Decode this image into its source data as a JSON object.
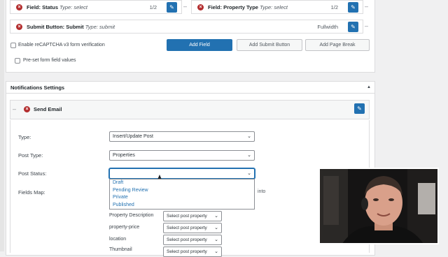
{
  "fields": [
    {
      "name": "Field: Status",
      "type": "Type: select",
      "width": "1/2"
    },
    {
      "name": "Field: Property Type",
      "type": "Type: select",
      "width": "1/2"
    },
    {
      "name": "Submit Button: Submit",
      "type": "Type: submit",
      "width": "Fullwidth"
    }
  ],
  "form_options": {
    "recaptcha_label": "Enable reCAPTCHA v3 form verification",
    "preset_label": "Pre-set form field values",
    "add_field": "Add Field",
    "add_submit": "Add Submit Button",
    "add_page_break": "Add Page Break"
  },
  "notifications": {
    "title": "Notifications Settings",
    "collapse_glyph": "▲",
    "action_title": "Send Email",
    "type_label": "Type:",
    "type_value": "Insert/Update Post",
    "post_type_label": "Post Type:",
    "post_type_value": "Properties",
    "post_status_label": "Post Status:",
    "post_status_value": "",
    "status_options": [
      "Draft",
      "Pending Review",
      "Private",
      "Published"
    ],
    "fields_map_label": "Fields Map:",
    "fields_map_hint_fragment": "into",
    "map_rows": [
      {
        "field": "Property Description",
        "select": "Select post property"
      },
      {
        "field": "property-price",
        "select": "Select post property"
      },
      {
        "field": "location",
        "select": "Select post property"
      },
      {
        "field": "Thumbnail",
        "select": "Select post property"
      }
    ]
  },
  "icons": {
    "remove": "×",
    "edit": "✎",
    "drag": "≡",
    "caret": "⌄",
    "dash": "–"
  },
  "colors": {
    "accent": "#2271b1",
    "danger": "#b32d2e",
    "background": "#f0f0f1"
  }
}
